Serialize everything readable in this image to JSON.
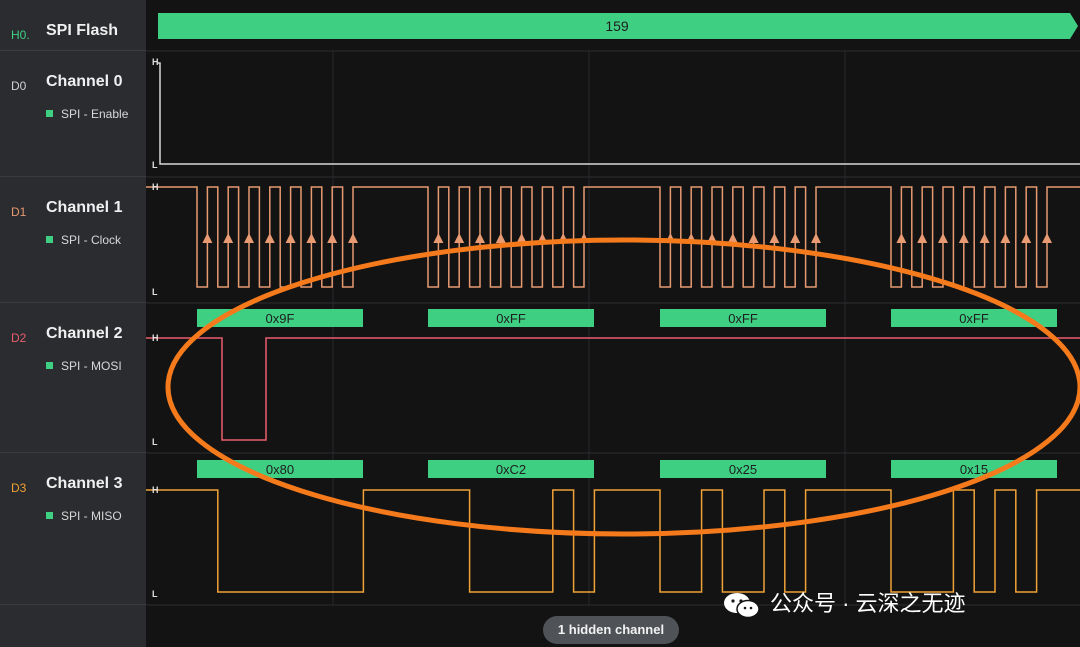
{
  "analyzer": {
    "decoder_row": {
      "id": "H0.",
      "name": "SPI Flash",
      "value": "159"
    },
    "channels": [
      {
        "id": "D0",
        "name": "Channel 0",
        "signal": "SPI - Enable",
        "color": "#d0d0d0"
      },
      {
        "id": "D1",
        "name": "Channel 1",
        "signal": "SPI - Clock",
        "color": "#e89a72"
      },
      {
        "id": "D2",
        "name": "Channel 2",
        "signal": "SPI - MOSI",
        "color": "#ea5e6e"
      },
      {
        "id": "D3",
        "name": "Channel 3",
        "signal": "SPI - MISO",
        "color": "#f0a237"
      }
    ],
    "level_high": "H",
    "level_low": "L",
    "mosi_bytes": [
      "0x9F",
      "0xFF",
      "0xFF",
      "0xFF"
    ],
    "miso_bytes": [
      "0x80",
      "0xC2",
      "0x25",
      "0x15"
    ],
    "hidden_channels_label": "1 hidden channel",
    "watermark": "公众号 · 云深之无迹",
    "accent_color": "#3fcf83",
    "annotation_color": "#f57a1c"
  }
}
